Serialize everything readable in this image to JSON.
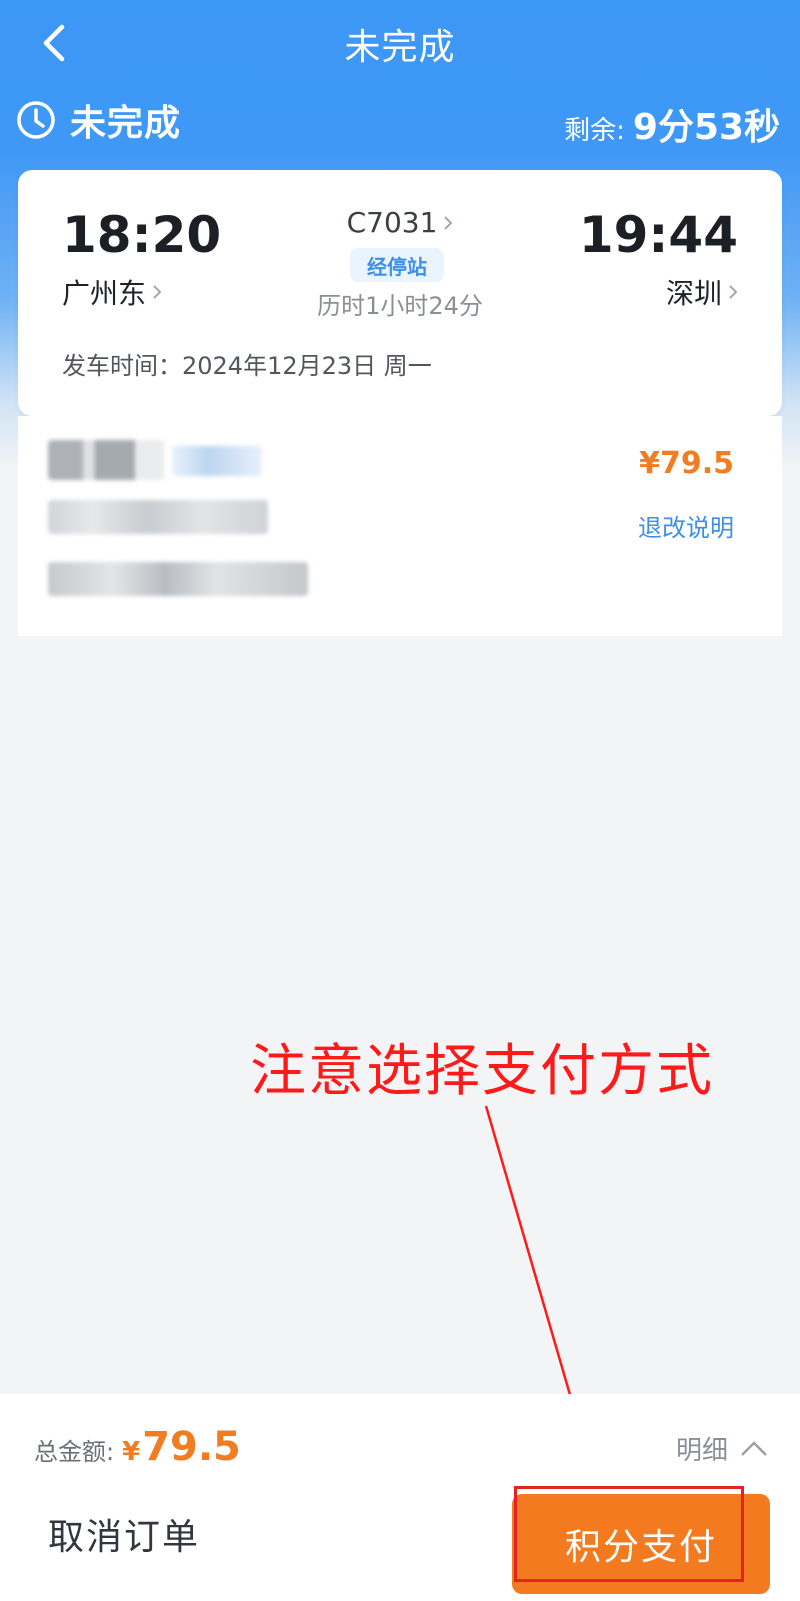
{
  "nav": {
    "title": "未完成",
    "back_icon": "chevron-left-icon"
  },
  "status": {
    "label": "未完成",
    "icon": "clock-icon",
    "remaining_label": "剩余:",
    "remaining_value": "9分53秒"
  },
  "train": {
    "departure_time": "18:20",
    "departure_station": "广州东",
    "arrival_time": "19:44",
    "arrival_station": "深圳",
    "train_number": "C7031",
    "stops_badge": "经停站",
    "duration": "历时1小时24分",
    "departure_date": "发车时间：2024年12月23日 周一"
  },
  "passenger": {
    "price": "¥79.5",
    "refund_link": "退改说明"
  },
  "annotation": {
    "text": "注意选择支付方式",
    "color": "#ff1a1a"
  },
  "bottom": {
    "total_label": "总金额:",
    "currency": "¥",
    "total_value": "79.5",
    "detail_label": "明细",
    "cancel_label": "取消订单",
    "pay_label": "积分支付"
  },
  "colors": {
    "primary_blue": "#3d97f5",
    "accent_orange": "#f37a1f",
    "link_blue": "#3d8fe8"
  }
}
